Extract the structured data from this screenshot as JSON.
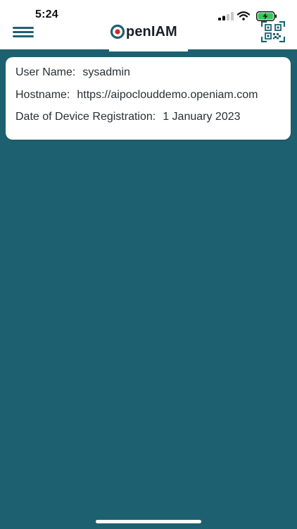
{
  "status_bar": {
    "time": "5:24"
  },
  "app_bar": {
    "logo_first": "O",
    "logo_rest": "penIAM",
    "menu_icon": "hamburger-menu-icon",
    "qr_icon": "qr-code-scanner-icon"
  },
  "colors": {
    "primary": "#1d6170",
    "card": "#ffffff",
    "logo_red": "#d4262c",
    "battery_green": "#34c759"
  },
  "device_info": {
    "user_name_label": "User Name:",
    "user_name_value": "sysadmin",
    "hostname_label": "Hostname:",
    "hostname_value": "https://aipoclouddemo.openiam.com",
    "registration_label": "Date of Device Registration:",
    "registration_value": "1 January 2023"
  }
}
